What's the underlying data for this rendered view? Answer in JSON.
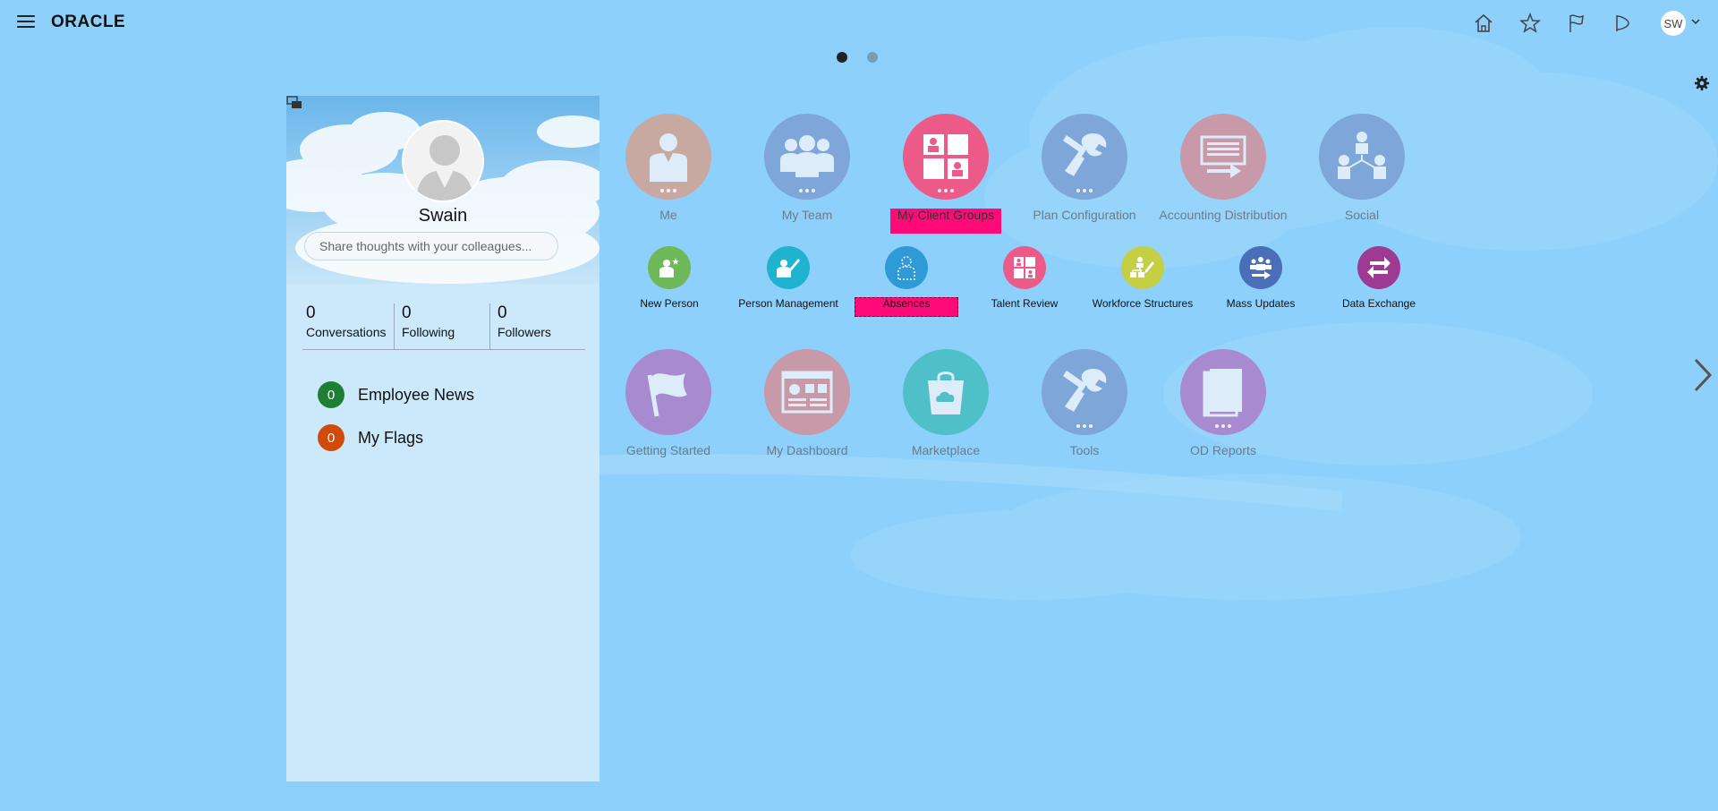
{
  "header": {
    "logo": "ORACLE",
    "avatar_initials": "SW"
  },
  "pagination": {
    "pages": 2,
    "active": 0
  },
  "profile": {
    "name": "Swain",
    "share_placeholder": "Share thoughts with your colleagues...",
    "stats": [
      {
        "value": "0",
        "label": "Conversations"
      },
      {
        "value": "0",
        "label": "Following"
      },
      {
        "value": "0",
        "label": "Followers"
      }
    ],
    "news": [
      {
        "count": "0",
        "label": "Employee News",
        "color": "#1e7e34"
      },
      {
        "count": "0",
        "label": "My Flags",
        "color": "#d04a0a"
      }
    ]
  },
  "apps": {
    "row1": [
      {
        "label": "Me",
        "color": "#c7a9a2",
        "icon": "person-icon"
      },
      {
        "label": "My Team",
        "color": "#7ea6d8",
        "icon": "team-icon"
      },
      {
        "label": "My Client Groups",
        "color": "#ec5a88",
        "icon": "client-groups-icon"
      },
      {
        "label": "Plan Configuration",
        "color": "#7ea6d8",
        "icon": "tools-icon"
      },
      {
        "label": "Accounting Distribution",
        "color": "#c89aa9",
        "icon": "distribution-icon"
      },
      {
        "label": "Social",
        "color": "#7ea6d8",
        "icon": "social-icon"
      }
    ],
    "row2": [
      {
        "label": "New Person",
        "color": "#6fb85a",
        "icon": "new-person-icon"
      },
      {
        "label": "Person Management",
        "color": "#1fb3cf",
        "icon": "person-management-icon"
      },
      {
        "label": "Absences",
        "color": "#2f9ad6",
        "icon": "absences-icon"
      },
      {
        "label": "Talent Review",
        "color": "#ec5a88",
        "icon": "talent-review-icon"
      },
      {
        "label": "Workforce Structures",
        "color": "#c5cf46",
        "icon": "workforce-structures-icon"
      },
      {
        "label": "Mass Updates",
        "color": "#4a6fb8",
        "icon": "mass-updates-icon"
      },
      {
        "label": "Data Exchange",
        "color": "#9d3b94",
        "icon": "data-exchange-icon"
      }
    ],
    "row3": [
      {
        "label": "Getting Started",
        "color": "#a88ad0",
        "icon": "flag-icon"
      },
      {
        "label": "My Dashboard",
        "color": "#c89aa9",
        "icon": "dashboard-icon"
      },
      {
        "label": "Marketplace",
        "color": "#4fc0c8",
        "icon": "marketplace-icon"
      },
      {
        "label": "Tools",
        "color": "#7ea6d8",
        "icon": "tools-icon"
      },
      {
        "label": "OD Reports",
        "color": "#a88ad0",
        "icon": "reports-icon"
      }
    ]
  },
  "colors": {
    "background": "#8dd0fb",
    "highlight": "#ff0a78"
  }
}
